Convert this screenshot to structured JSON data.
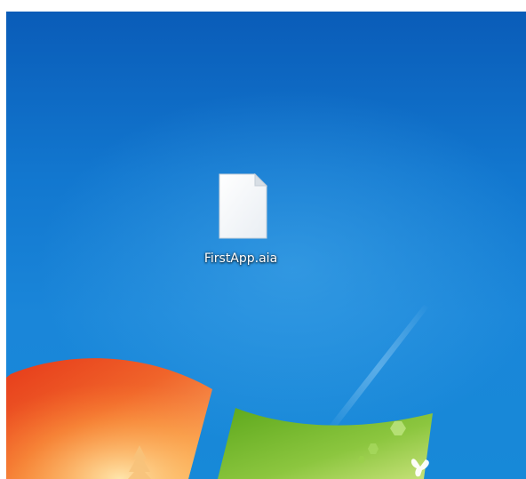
{
  "desktop": {
    "icons": [
      {
        "name": "FirstApp.aia",
        "icon": "blank-document-icon"
      }
    ]
  },
  "colors": {
    "desktop_blue": "#1277cf",
    "logo_red": "#f05a28",
    "logo_green": "#7cbb2a"
  }
}
